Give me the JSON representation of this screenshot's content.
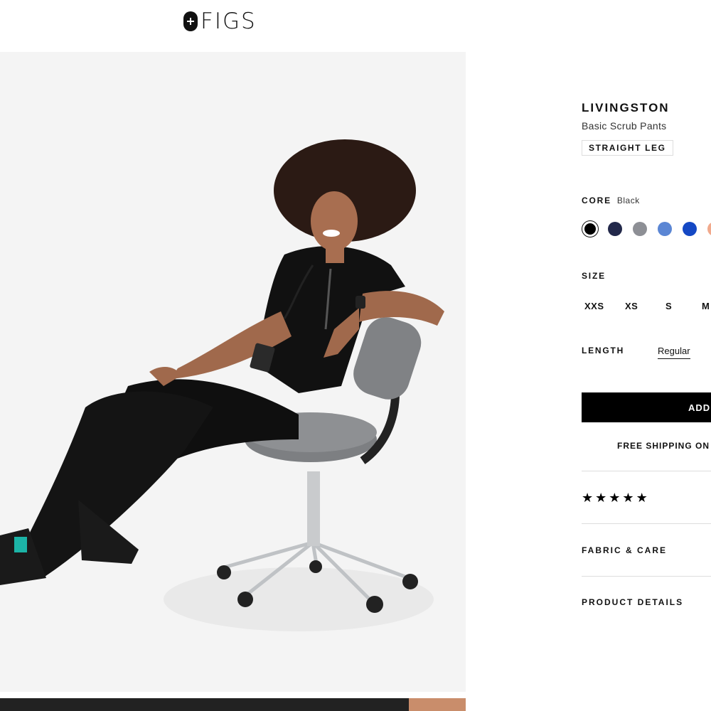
{
  "header": {
    "logo_text": "FIGS"
  },
  "product": {
    "name": "LIVINGSTON",
    "subtitle": "Basic Scrub Pants",
    "fit_tag": "STRAIGHT LEG"
  },
  "color": {
    "label": "CORE",
    "selected_name": "Black",
    "swatches": [
      "#000000",
      "#22284a",
      "#8d8f95",
      "#5b86d4",
      "#1448c4",
      "#f1a98c"
    ]
  },
  "size": {
    "label": "SIZE",
    "options": [
      "XXS",
      "XS",
      "S",
      "M"
    ]
  },
  "length": {
    "label": "LENGTH",
    "selected": "Regular"
  },
  "cta": {
    "add_label": "ADD",
    "shipping_text": "FREE SHIPPING ON "
  },
  "reviews": {
    "stars": [
      "★",
      "★",
      "★",
      "★",
      "★"
    ]
  },
  "accordion": {
    "fabric_care": "FABRIC & CARE",
    "product_details": "PRODUCT DETAILS"
  }
}
